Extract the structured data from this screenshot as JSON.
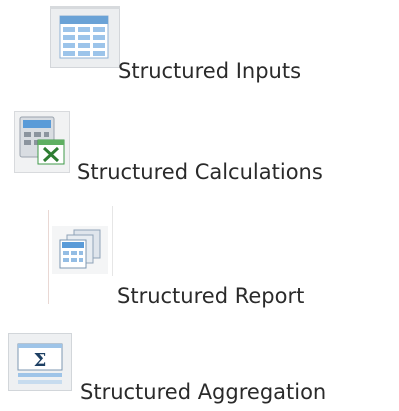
{
  "items": [
    {
      "label": "Structured Inputs",
      "icon": "table-grid-icon"
    },
    {
      "label": "Structured Calculations",
      "icon": "spreadsheet-calculator-icon"
    },
    {
      "label": "Structured Report",
      "icon": "stacked-pages-icon"
    },
    {
      "label": "Structured Aggregation",
      "icon": "sigma-sum-icon"
    }
  ]
}
